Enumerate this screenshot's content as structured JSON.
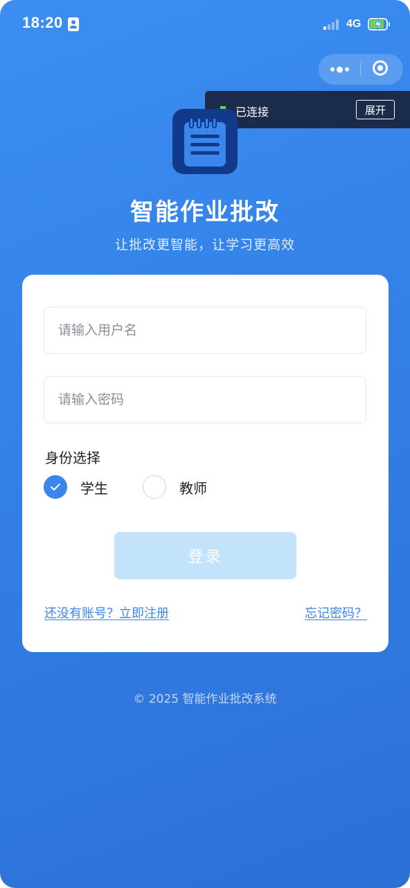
{
  "status_bar": {
    "time": "18:20",
    "network": "4G"
  },
  "debug_bar": {
    "status_text": "已连接",
    "expand_label": "展开"
  },
  "app": {
    "title": "智能作业批改",
    "subtitle": "让批改更智能，让学习更高效",
    "icon": "notepad-icon"
  },
  "form": {
    "username_placeholder": "请输入用户名",
    "password_placeholder": "请输入密码",
    "role_label": "身份选择",
    "roles": [
      {
        "label": "学生",
        "selected": true
      },
      {
        "label": "教师",
        "selected": false
      }
    ],
    "login_label": "登录",
    "register_link": "还没有账号？立即注册",
    "forgot_link": "忘记密码？"
  },
  "footer": {
    "copyright": "© 2025 智能作业批改系统"
  },
  "colors": {
    "background": "#3380e8",
    "accent": "#3a86ea",
    "logo_bg": "#123a8c",
    "button_disabled": "#c3e3fb",
    "connected": "#5fd35f"
  }
}
